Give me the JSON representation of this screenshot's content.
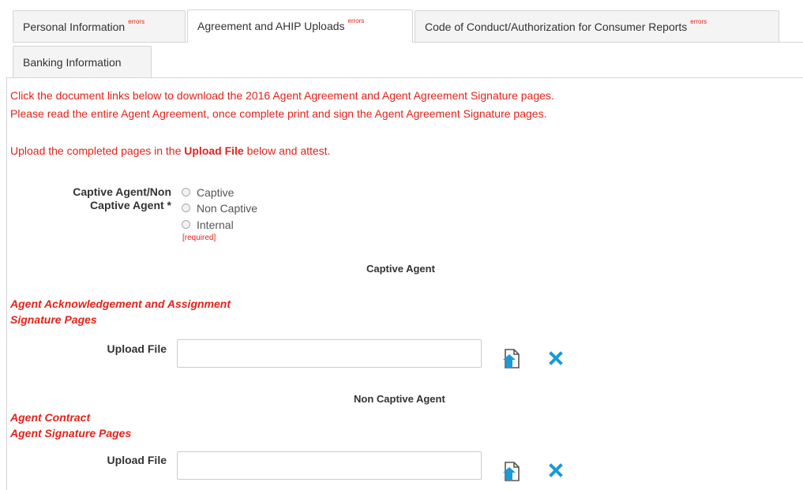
{
  "tabs": [
    {
      "label": "Personal Information",
      "badge": "errors"
    },
    {
      "label": "Agreement and AHIP Uploads",
      "badge": "errors"
    },
    {
      "label": "Code of Conduct/Authorization for Consumer Reports",
      "badge": "errors"
    },
    {
      "label": "Banking Information",
      "badge": ""
    }
  ],
  "intro": {
    "line1": "Click the document links below to download the 2016 Agent Agreement and Agent Agreement Signature pages.",
    "line2": "Please read the entire Agent Agreement, once complete print and sign the Agent Agreement Signature pages.",
    "line3_pre": "Upload the completed pages in the ",
    "line3_bold": "Upload File",
    "line3_post": " below and attest."
  },
  "captive_field": {
    "label_line1": "Captive Agent/Non",
    "label_line2": "Captive Agent *",
    "options": [
      "Captive",
      "Non Captive",
      "Internal"
    ],
    "required_text": "[required]"
  },
  "captive_section": {
    "title": "Captive Agent",
    "doc_line1": "Agent Acknowledgement and Assignment",
    "doc_line2": "Signature Pages",
    "upload_label": "Upload File"
  },
  "noncaptive_section": {
    "title": "Non Captive Agent",
    "doc_line1": "Agent Contract",
    "doc_line2": "Agent Signature Pages",
    "upload_label": "Upload File"
  },
  "colors": {
    "error_red": "#e2231a",
    "icon_blue": "#1a9ad6"
  },
  "icons": {
    "upload": "upload-file-icon",
    "clear": "close-icon"
  }
}
